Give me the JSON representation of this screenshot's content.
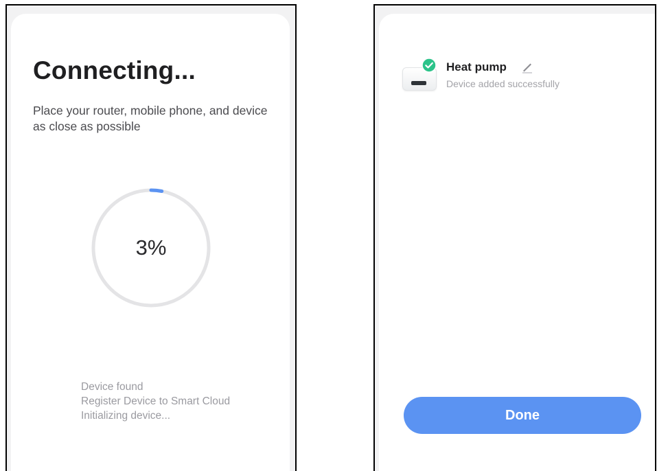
{
  "connecting_screen": {
    "title": "Connecting...",
    "subtitle": "Place your router, mobile phone, and device as close as possible",
    "progress": {
      "value_label": "3%",
      "percent": 3,
      "track_color": "#e4e4e6",
      "fill_color": "#5b93f2"
    },
    "steps": [
      "Device found",
      "Register Device to Smart Cloud",
      "Initializing device..."
    ]
  },
  "success_screen": {
    "device": {
      "name": "Heat pump",
      "status": "Device added successfully",
      "icon": "heat-pump-device-icon",
      "badge_icon": "check-circle-icon",
      "edit_icon": "pencil-icon",
      "badge_color": "#2cc38a"
    },
    "done_button": {
      "label": "Done",
      "color": "#5b93f2"
    }
  }
}
